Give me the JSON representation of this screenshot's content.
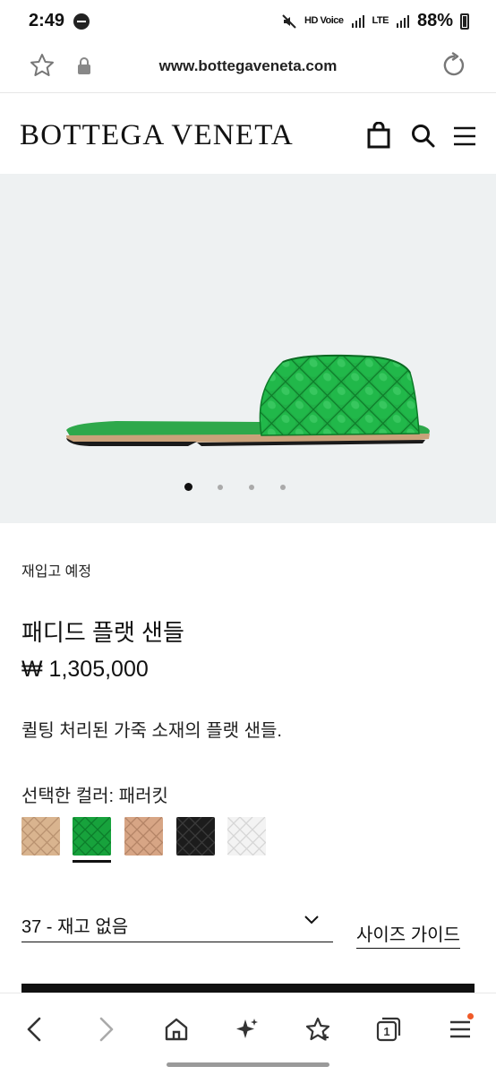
{
  "status_bar": {
    "time": "2:49",
    "battery": "88%",
    "indicators": [
      "mute-icon",
      "HD Voice",
      "R",
      "LTE",
      "R"
    ]
  },
  "browser": {
    "url": "www.bottegaveneta.com"
  },
  "site": {
    "brand": "BOTTEGA VENETA",
    "header_icons": [
      "bag-icon",
      "search-icon",
      "menu-icon"
    ]
  },
  "product": {
    "restock_notice": "재입고 예정",
    "title": "패디드 플랫 샌들",
    "price": "₩ 1,305,000",
    "description": "퀼팅 처리된 가죽 소재의 플랫 샌들.",
    "selected_color_label": "선택한 컬러: 패러킷",
    "swatches": [
      {
        "color": "#d9b48f"
      },
      {
        "color": "#17a23c",
        "selected": true
      },
      {
        "color": "#d7a585"
      },
      {
        "color": "#1c1c1c"
      },
      {
        "color": "#f3f3f3"
      }
    ],
    "size_value": "37 - 재고 없음",
    "size_guide": "사이즈 가이드",
    "gallery": {
      "slides": 4,
      "active": 1
    }
  },
  "bottom_nav": [
    "back-icon",
    "forward-icon",
    "home-icon",
    "sparkle-icon",
    "bookmark-star-icon",
    "tabs-icon",
    "menu-icon"
  ],
  "colors": {
    "accent_green": "#17a23c",
    "notification_dot": "#f05a28"
  }
}
